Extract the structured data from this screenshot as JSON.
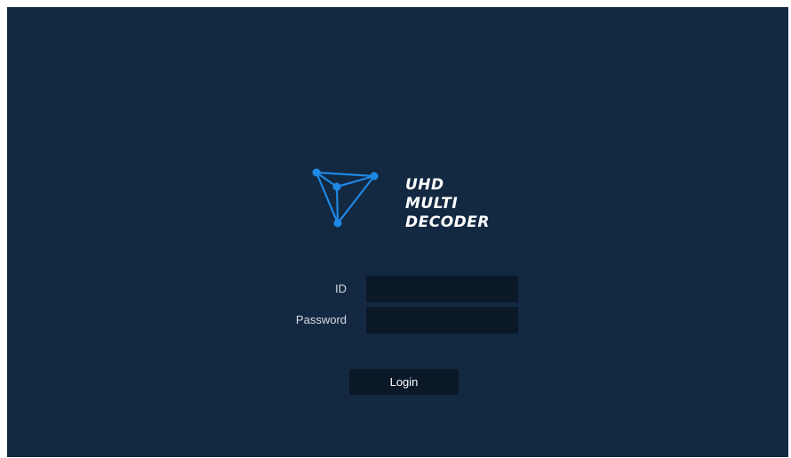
{
  "brand": {
    "lines": [
      "UHD",
      "MULTI",
      "DECODER"
    ],
    "logo_icon": "triangle-network-logo",
    "accent_color": "#1e88e5"
  },
  "login_form": {
    "id_label": "ID",
    "id_value": "",
    "password_label": "Password",
    "password_value": "",
    "login_label": "Login"
  },
  "colors": {
    "background": "#132841",
    "field_background": "#0b1828",
    "text": "#ffffff"
  }
}
